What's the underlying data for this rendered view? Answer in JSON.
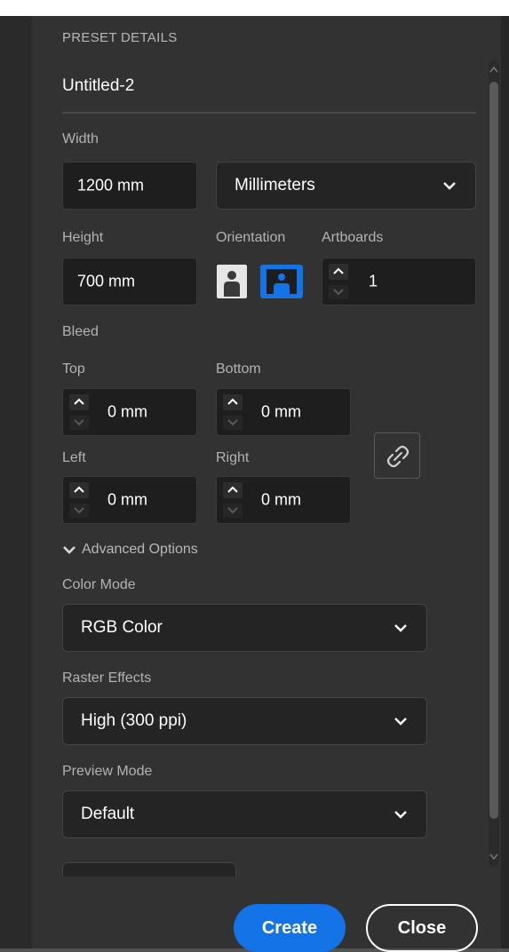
{
  "panel": {
    "section_title": "PRESET DETAILS",
    "doc_name": "Untitled-2"
  },
  "size": {
    "width_label": "Width",
    "width_value": "1200 mm",
    "units_value": "Millimeters",
    "height_label": "Height",
    "height_value": "700 mm",
    "orientation_label": "Orientation",
    "artboards_label": "Artboards",
    "artboards_value": "1"
  },
  "bleed": {
    "label": "Bleed",
    "top_label": "Top",
    "top_value": "0 mm",
    "bottom_label": "Bottom",
    "bottom_value": "0 mm",
    "left_label": "Left",
    "left_value": "0 mm",
    "right_label": "Right",
    "right_value": "0 mm"
  },
  "advanced": {
    "toggle_label": "Advanced Options",
    "color_mode_label": "Color Mode",
    "color_mode_value": "RGB Color",
    "raster_label": "Raster Effects",
    "raster_value": "High (300 ppi)",
    "preview_label": "Preview Mode",
    "preview_value": "Default"
  },
  "actions": {
    "create_label": "Create",
    "close_label": "Close"
  },
  "colors": {
    "accent": "#1473e6",
    "panel_bg": "#323232",
    "field_bg": "#1e1e1e"
  }
}
